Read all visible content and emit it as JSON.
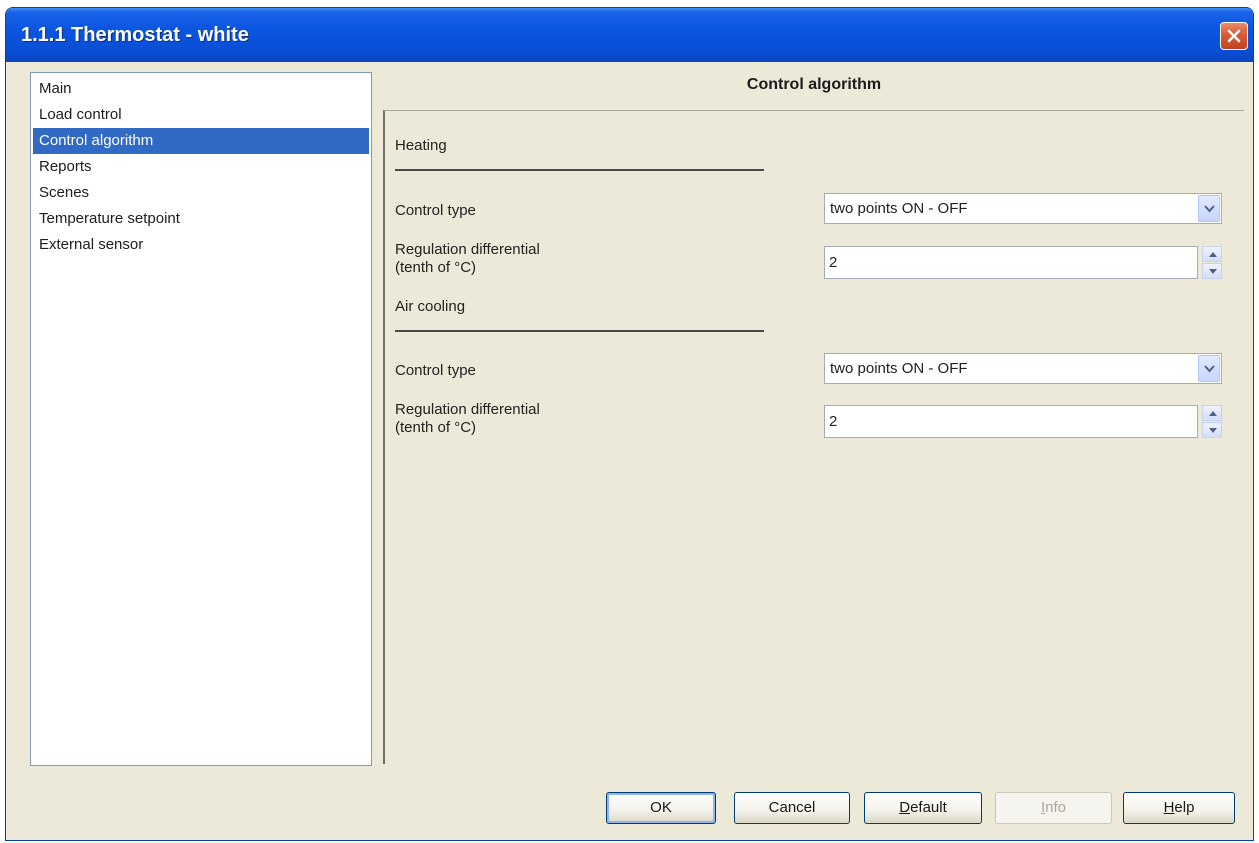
{
  "window": {
    "title": "1.1.1 Thermostat - white"
  },
  "sidebar": {
    "items": [
      {
        "label": "Main",
        "selected": false
      },
      {
        "label": "Load control",
        "selected": false
      },
      {
        "label": "Control algorithm",
        "selected": true
      },
      {
        "label": "Reports",
        "selected": false
      },
      {
        "label": "Scenes",
        "selected": false
      },
      {
        "label": "Temperature setpoint",
        "selected": false
      },
      {
        "label": "External sensor",
        "selected": false
      }
    ]
  },
  "panel": {
    "title": "Control algorithm",
    "heating": {
      "section_label": "Heating",
      "control_type_label": "Control type",
      "control_type_value": "two points ON - OFF",
      "differential_label_line1": "Regulation differential",
      "differential_label_line2": "(tenth of °C)",
      "differential_value": "2"
    },
    "cooling": {
      "section_label": "Air cooling",
      "control_type_label": "Control type",
      "control_type_value": "two points ON - OFF",
      "differential_label_line1": "Regulation differential",
      "differential_label_line2": "(tenth of °C)",
      "differential_value": "2"
    }
  },
  "buttons": {
    "ok": "OK",
    "cancel": "Cancel",
    "default_first": "D",
    "default_rest": "efault",
    "info_first": "I",
    "info_rest": "nfo",
    "help_first": "H",
    "help_rest": "elp"
  },
  "colors": {
    "title_bar": "#0a55e0",
    "selection": "#316ac5",
    "dialog_face": "#ece9d8",
    "close_button": "#d95a35"
  },
  "icons": [
    "close-icon",
    "chevron-down-icon",
    "spin-up-icon",
    "spin-down-icon"
  ]
}
